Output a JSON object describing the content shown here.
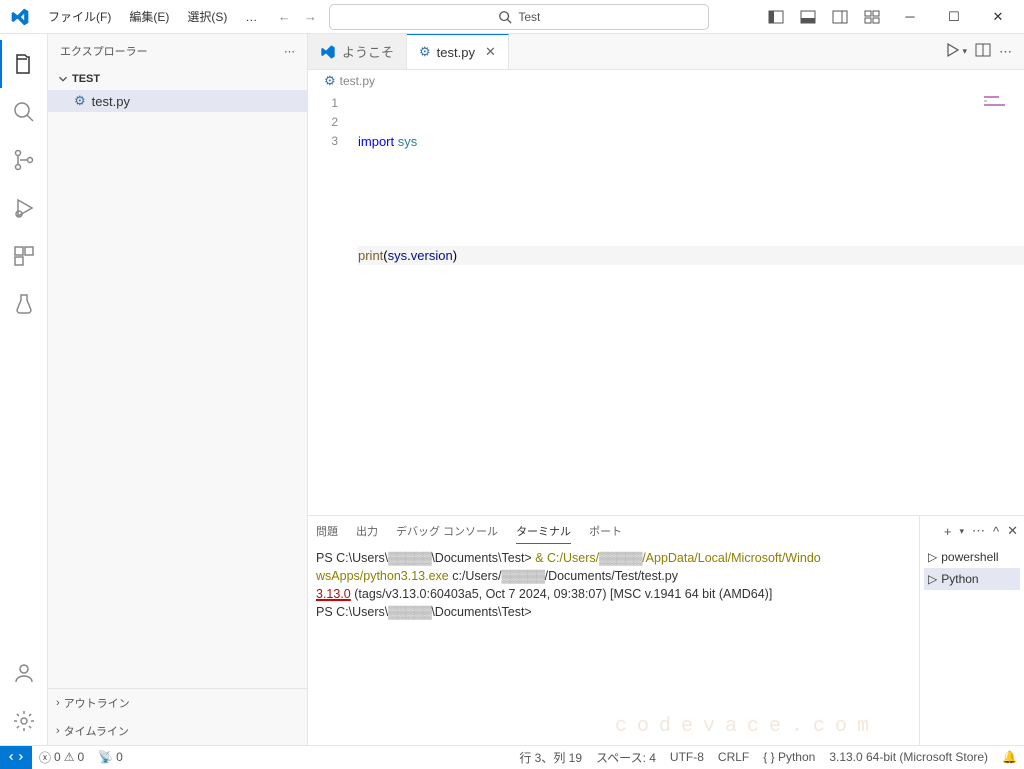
{
  "menu": {
    "file": "ファイル(F)",
    "edit": "編集(E)",
    "select": "選択(S)",
    "more": "…"
  },
  "search": {
    "text": "Test"
  },
  "sidebar": {
    "title": "エクスプローラー",
    "folder": "TEST",
    "file": "test.py",
    "outline": "アウトライン",
    "timeline": "タイムライン"
  },
  "tabs": {
    "welcome": "ようこそ",
    "file": "test.py"
  },
  "breadcrumb": {
    "file": "test.py"
  },
  "code": {
    "line1": {
      "kw": "import",
      "mod": "sys"
    },
    "line3": {
      "fn": "print",
      "open": "(",
      "var1": "sys",
      "dot": ".",
      "var2": "version",
      "close": ")"
    }
  },
  "panel": {
    "tabs": {
      "problems": "問題",
      "output": "出力",
      "debug": "デバッグ コンソール",
      "terminal": "ターミナル",
      "ports": "ポート"
    },
    "terminals": {
      "powershell": "powershell",
      "python": "Python"
    }
  },
  "terminal": {
    "l1a": "PS C:\\Users\\",
    "l1b": "\\Documents\\Test> ",
    "l1c": "& C:/Users/",
    "l1d": "/AppData/Local/Microsoft/Windo",
    "l2a": "wsApps/python3.13.exe",
    "l2b": " c:/Users/",
    "l2c": "/Documents/Test/test.py",
    "l3a": "3.13.0",
    "l3b": " (tags/v3.13.0:60403a5, Oct  7 2024, 09:38:07) [MSC v.1941 64 bit (AMD64)]",
    "l4a": "PS C:\\Users\\",
    "l4b": "\\Documents\\Test>"
  },
  "status": {
    "errors": "0",
    "warnings": "0",
    "ports": "0",
    "cursor": "行 3、列 19",
    "spaces": "スペース: 4",
    "encoding": "UTF-8",
    "eol": "CRLF",
    "lang": "{ } Python",
    "interp": "3.13.0 64-bit (Microsoft Store)"
  },
  "watermark": "codevace.com"
}
